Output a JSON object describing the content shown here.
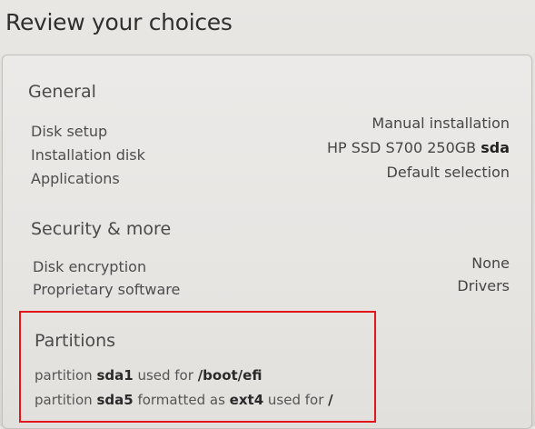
{
  "page_title": "Review your choices",
  "general": {
    "heading": "General",
    "rows": [
      {
        "label": "Disk setup",
        "value": "Manual installation",
        "value_bold": ""
      },
      {
        "label": "Installation disk",
        "value": "HP SSD S700 250GB ",
        "value_bold": "sda"
      },
      {
        "label": "Applications",
        "value": "Default selection",
        "value_bold": ""
      }
    ]
  },
  "security": {
    "heading": "Security & more",
    "rows": [
      {
        "label": "Disk encryption",
        "value": "None"
      },
      {
        "label": "Proprietary software",
        "value": "Drivers"
      }
    ]
  },
  "partitions": {
    "heading": "Partitions",
    "lines": [
      {
        "t1": "partition ",
        "b1": "sda1",
        "t2": " used for ",
        "b2": "/boot/efi",
        "t3": "",
        "b3": ""
      },
      {
        "t1": "partition ",
        "b1": "sda5",
        "t2": " formatted as ",
        "b2": "ext4",
        "t3": " used for ",
        "b3": "/"
      }
    ]
  },
  "colors": {
    "highlight_border": "#e3161c"
  }
}
